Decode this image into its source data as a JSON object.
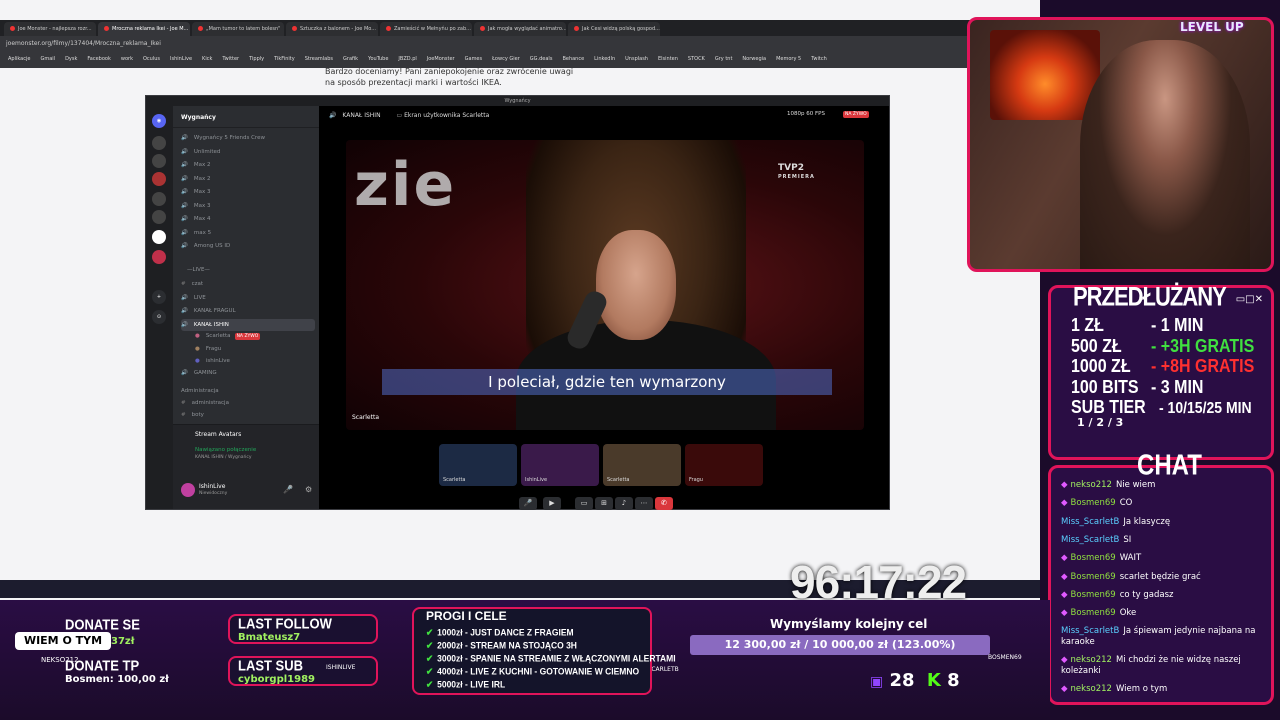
{
  "browser": {
    "tabs": [
      "Joe Monster - najlepsza rozr...",
      "Mroczna reklama Ikei - Joe M...",
      "„Mam tumor to latem bolesn\"",
      "Sztuczka z balonem - Joe Mo...",
      "Zamieścić w Mełnyńu po zab...",
      "Jak mogła wyglądać animatro...",
      "Jak Cesi widzą polską gospod..."
    ],
    "address": "joemonster.org/filmy/137404/Mroczna_reklama_Ikei",
    "bookmarks": [
      "Aplikacje",
      "Gmail",
      "Dysk",
      "Facebook",
      "work",
      "Oculus",
      "IshinLive",
      "Kick",
      "Twitter",
      "Tipply",
      "TikFinity",
      "Streamlabs",
      "Grafik",
      "YouTube",
      "JBZD.pl",
      "JoeMonster",
      "Games",
      "Łowcy Gier",
      "GG.deals",
      "Behance",
      "LinkedIn",
      "Unsplash",
      "Elsinten",
      "STOCK",
      "Gry tnt",
      "Norwegia",
      "Memory 5",
      "Twitch"
    ],
    "article_text": "Bardzo doceniamy! Pani zaniepokojenie oraz zwrócenie uwagi na sposób prezentacji marki i wartości IKEA."
  },
  "discord": {
    "title": "Wygnańcy",
    "server": "Wygnańcy",
    "channels": [
      {
        "name": "Wygnańcy 5 Friends Crew",
        "icon": "🔊"
      },
      {
        "name": "Unlimited",
        "icon": "🔊"
      },
      {
        "name": "Max 2",
        "icon": "🔊"
      },
      {
        "name": "Max 2",
        "icon": "🔊"
      },
      {
        "name": "Max 3",
        "icon": "🔊"
      },
      {
        "name": "Max 3",
        "icon": "🔊"
      },
      {
        "name": "Max 4",
        "icon": "🔊"
      },
      {
        "name": "max 5",
        "icon": "🔊"
      },
      {
        "name": "Among US ID",
        "icon": "🔊"
      },
      {
        "name": "—LIVE—",
        "icon": ""
      },
      {
        "name": "czat",
        "icon": "#"
      },
      {
        "name": "LIVE",
        "icon": "🔊"
      },
      {
        "name": "KANAŁ FRAGUL",
        "icon": "🔊"
      },
      {
        "name": "KANAŁ ISHIN",
        "icon": "🔊"
      }
    ],
    "voice_users": [
      "Scarletta",
      "Fragu",
      "ishinLive"
    ],
    "live_badge": "NA ŻYWO",
    "gaming": "GAMING",
    "admin": "Administracja",
    "admin_ch": "administracja",
    "boty": "boty",
    "stream_avatars": "Stream Avatars",
    "connected": "Nawiązano połączenie",
    "connected_sub": "KANAŁ ISHIN / Wygnańcy",
    "user": "IshinLive",
    "user_status": "Niewidoczny",
    "main_channel": "KANAŁ ISHIN",
    "screen_label": "Ekran użytkownika Scarletta",
    "quality": "1080p 60 FPS",
    "video_word": "zie",
    "tvp": "TVP2",
    "tvp_sub": "PREMIERA",
    "subtitle": "I poleciał, gdzie ten wymarzony",
    "video_label": "Scarletta",
    "thumbs": [
      "Scarletta",
      "IshinLive",
      "Scarletta",
      "Fragu"
    ]
  },
  "webcam": {
    "overlay": "LEVEL UP"
  },
  "przedluzany": {
    "title": "PRZEDŁUŻANY",
    "rows": [
      {
        "k": "1 ZŁ",
        "v": "- 1 MIN"
      },
      {
        "k": "500 ZŁ",
        "v": "- +3H GRATIS"
      },
      {
        "k": "1000 ZŁ",
        "v": "- +8H GRATIS"
      },
      {
        "k": "100 BITS",
        "v": "- 3 MIN"
      },
      {
        "k": "SUB TIER",
        "v": "- 10/15/25 MIN"
      }
    ],
    "tier_sub": "1 / 2 / 3"
  },
  "chat": {
    "title": "CHAT",
    "messages": [
      {
        "user": "nekso212",
        "text": "Nie wiem"
      },
      {
        "user": "Bosmen69",
        "text": "CO"
      },
      {
        "user": "Miss_ScarletB",
        "text": "Ja klasyczę"
      },
      {
        "user": "Miss_ScarletB",
        "text": "SI"
      },
      {
        "user": "Bosmen69",
        "text": "WAIT"
      },
      {
        "user": "Bosmen69",
        "text": "scarlet będzie grać"
      },
      {
        "user": "Bosmen69",
        "text": "co ty gadasz"
      },
      {
        "user": "Bosmen69",
        "text": "Oke"
      },
      {
        "user": "Miss_ScarletB",
        "text": "Ja śpiewam jedynie najbana na karaoke"
      },
      {
        "user": "nekso212",
        "text": "Mi chodzi że nie widzę naszej koleżanki"
      },
      {
        "user": "nekso212",
        "text": "Wiem o tym"
      }
    ]
  },
  "timer": "96:17:22",
  "bottom": {
    "donate_se": "DONATE SE",
    "donate_se_val": "37zł",
    "donate_tp": "DONATE TP",
    "donate_tp_val": "Bosmen: 100,00 zł",
    "wiem": "WIEM O TYM",
    "nekso": "NEKSO212",
    "last_follow": "LAST FOLLOW",
    "last_follow_val": "Bmateusz7",
    "last_sub": "LAST SUB",
    "last_sub_val": "cyborgpl1989",
    "ishin": "ISHINLIVE",
    "progi_title": "PROGI I CELE",
    "progi": [
      "1000zł - JUST DANCE Z FRAGIEM",
      "2000zł - STREAM NA STOJĄCO 3H",
      "3000zł - SPANIE NA STREAMIE Z WŁĄCZONYMI ALERTAMI",
      "4000zł - LIVE Z KUCHNI - GOTOWANIE W CIEMNO",
      "5000zł - LIVE IRL"
    ],
    "miss": "MISS_SCARLETB",
    "goal_title": "Wymyślamy kolejny cel",
    "goal_text": "12 300,00 zł / 10 000,00 zł (123.00%)",
    "goal_progress": 1.23,
    "bosmen": "BOSMEN69",
    "viewers": "28",
    "kick": "8"
  }
}
